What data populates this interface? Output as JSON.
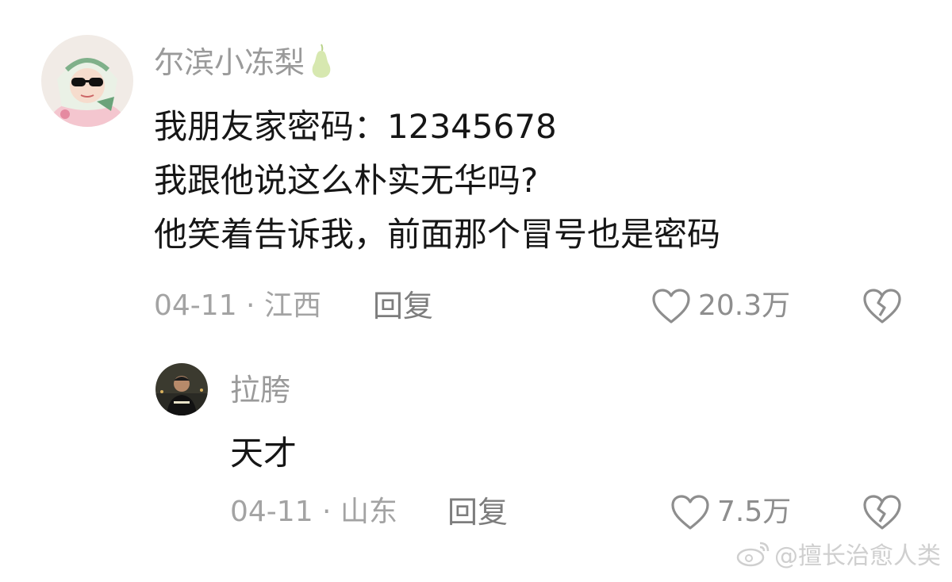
{
  "comments": [
    {
      "username": "尔滨小冻梨",
      "lines": [
        "我朋友家密码：12345678",
        "我跟他说这么朴实无华吗?",
        "他笑着告诉我，前面那个冒号也是密码"
      ],
      "meta": "04-11 · 江西",
      "reply_label": "回复",
      "likes": "20.3万"
    }
  ],
  "replies": [
    {
      "username": "拉胯",
      "text": "天才",
      "meta": "04-11 · 山东",
      "reply_label": "回复",
      "likes": "7.5万"
    }
  ],
  "watermark": {
    "text": "@擅长治愈人类",
    "icon": "weibo-icon"
  },
  "icons": {
    "username_badge": "pear-icon",
    "like": "heart-outline-icon",
    "dislike": "broken-heart-icon"
  },
  "colors": {
    "username": "#9a9a9a",
    "text": "#161616",
    "meta": "#a3a3a3",
    "icon": "#8e8e8e",
    "pear": "#d7e8b0"
  }
}
